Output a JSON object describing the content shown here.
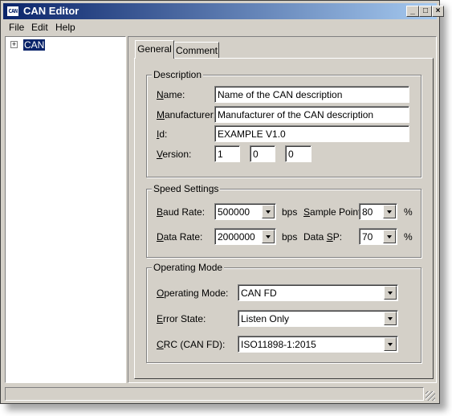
{
  "window": {
    "title": "CAN Editor",
    "app_icon_text": "CAN",
    "buttons": {
      "minimize": "_",
      "maximize": "□",
      "close": "×"
    }
  },
  "menu": {
    "file": "File",
    "edit": "Edit",
    "help": "Help"
  },
  "tree": {
    "expander": "+",
    "root_label": "CAN"
  },
  "tabs": {
    "general": "General",
    "comment": "Comment"
  },
  "description": {
    "title": "Description",
    "name": {
      "label_u": "N",
      "label_rest": "ame:",
      "value": "Name of the CAN description"
    },
    "manufacturer": {
      "label_u": "M",
      "label_rest": "anufacturer:",
      "value": "Manufacturer of the CAN description"
    },
    "id": {
      "label_u": "I",
      "label_rest": "d:",
      "value": "EXAMPLE V1.0"
    },
    "version": {
      "label_u": "V",
      "label_rest": "ersion:",
      "major": "1",
      "minor": "0",
      "patch": "0"
    }
  },
  "speed": {
    "title": "Speed Settings",
    "baud_rate": {
      "label_u": "B",
      "label_rest": "aud Rate:",
      "value": "500000",
      "unit": "bps"
    },
    "sample_point": {
      "label_u": "S",
      "label_rest": "ample Point:",
      "value": "80",
      "unit": "%"
    },
    "data_rate": {
      "label_u": "D",
      "label_rest": "ata Rate:",
      "value": "2000000",
      "unit": "bps"
    },
    "data_sp": {
      "label_pre": "Data ",
      "label_u": "S",
      "label_rest": "P:",
      "value": "70",
      "unit": "%"
    }
  },
  "operating": {
    "title": "Operating Mode",
    "mode": {
      "label_u": "O",
      "label_rest": "perating Mode:",
      "value": "CAN FD"
    },
    "error_state": {
      "label_u": "E",
      "label_rest": "rror State:",
      "value": "Listen Only"
    },
    "crc": {
      "label_u": "C",
      "label_rest": "RC (CAN FD):",
      "value": "ISO11898-1:2015"
    }
  },
  "colors": {
    "title_start": "#0a246a",
    "title_end": "#a6caf0",
    "face": "#d4d0c8",
    "selection": "#0a246a"
  }
}
